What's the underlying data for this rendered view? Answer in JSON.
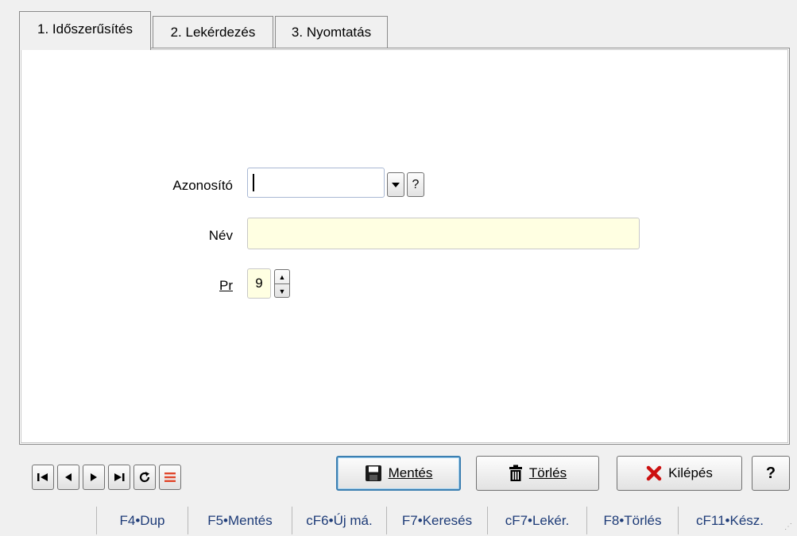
{
  "tabs": [
    {
      "label": "1. Időszerűsítés",
      "active": true
    },
    {
      "label": "2. Lekérdezés",
      "active": false
    },
    {
      "label": "3. Nyomtatás",
      "active": false
    }
  ],
  "form": {
    "azonosito_label": "Azonosító",
    "azonosito_value": "",
    "nev_label": "Név",
    "nev_value": "",
    "pr_label": "Pr",
    "pr_value": "9",
    "help_glyph": "?"
  },
  "buttons": {
    "save": "Mentés",
    "delete": "Törlés",
    "exit": "Kilépés",
    "help": "?"
  },
  "icons": {
    "first": "first-record-icon",
    "prev": "previous-record-icon",
    "next": "next-record-icon",
    "last": "last-record-icon",
    "refresh": "refresh-icon",
    "list": "list-icon",
    "save": "save-disk-icon",
    "delete": "trash-icon",
    "exit": "red-x-icon"
  },
  "statusbar": [
    "F4•Dup",
    "F5•Mentés",
    "cF6•Új má.",
    "F7•Keresés",
    "cF7•Lekér.",
    "F8•Törlés",
    "cF11•Kész."
  ],
  "colors": {
    "accent": "#3c7fb1",
    "input_yellow": "#ffffe2",
    "list_icon": "#e0462b",
    "exit_icon": "#cc1111"
  }
}
